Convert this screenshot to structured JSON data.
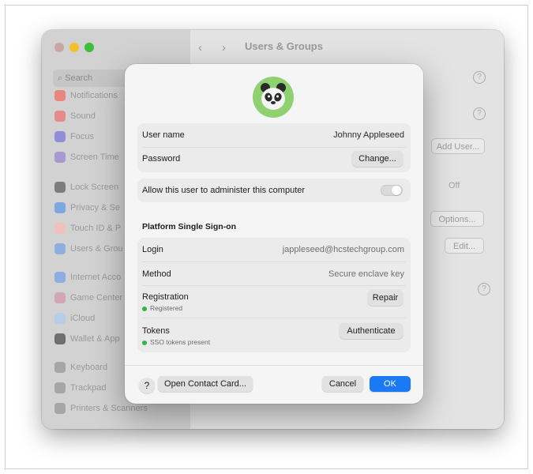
{
  "background": {
    "window_title": "Users & Groups",
    "nav_back": "‹",
    "nav_forward": "›",
    "search_placeholder": "Search",
    "search_icon": "magnifier-icon",
    "sidebar": [
      {
        "label": "Notifications",
        "color": "#e9857f"
      },
      {
        "label": "Sound",
        "color": "#e58b8b"
      },
      {
        "label": "Focus",
        "color": "#8f8ed7"
      },
      {
        "label": "Screen Time",
        "color": "#a79ad0"
      },
      {
        "label": "Lock Screen",
        "color": "#7d7d7d"
      },
      {
        "label": "Privacy & Se",
        "color": "#7ea7e2"
      },
      {
        "label": "Touch ID & P",
        "color": "#f0c0bd"
      },
      {
        "label": "Users & Grou",
        "color": "#8eaee0"
      },
      {
        "label": "Internet Acco",
        "color": "#8eaee0"
      },
      {
        "label": "Game Center",
        "color": "#d3a6b5"
      },
      {
        "label": "iCloud",
        "color": "#b7cce9"
      },
      {
        "label": "Wallet & App",
        "color": "#6f6f6f"
      },
      {
        "label": "Keyboard",
        "color": "#a6a6a6"
      },
      {
        "label": "Trackpad",
        "color": "#a6a6a6"
      },
      {
        "label": "Printers & Scanners",
        "color": "#a6a6a6"
      }
    ],
    "add_user_label": "Add User...",
    "options_label": "Options...",
    "edit_label": "Edit...",
    "off_label": "Off",
    "info_glyph": "ⓘ",
    "help_glyph": "?"
  },
  "dialog": {
    "avatar_icon": "panda-avatar-icon",
    "user_name_label": "User name",
    "user_name_value": "Johnny Appleseed",
    "password_label": "Password",
    "change_label": "Change...",
    "admin_label": "Allow this user to administer this computer",
    "admin_enabled": false,
    "sso_title": "Platform Single Sign-on",
    "login_label": "Login",
    "login_value": "jappleseed@hcstechgroup.com",
    "method_label": "Method",
    "method_value": "Secure enclave key",
    "registration_label": "Registration",
    "registration_status": "Registered",
    "repair_label": "Repair",
    "tokens_label": "Tokens",
    "tokens_status": "SSO tokens present",
    "authenticate_label": "Authenticate",
    "help_label": "?",
    "open_contact_label": "Open Contact Card...",
    "cancel_label": "Cancel",
    "ok_label": "OK",
    "accent": "#1a79f5",
    "status_color": "#32b548"
  }
}
